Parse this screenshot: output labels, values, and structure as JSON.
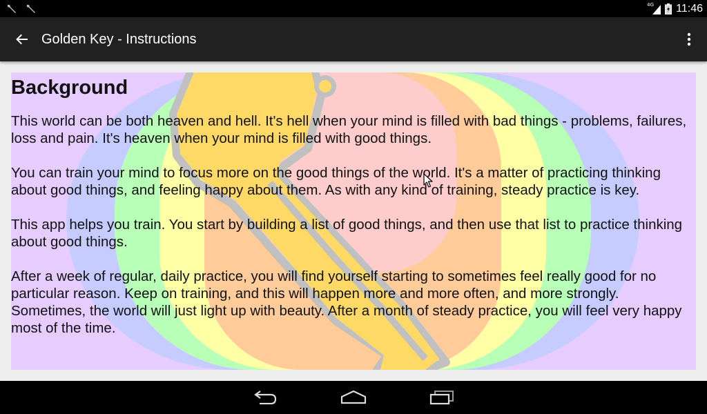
{
  "status_bar": {
    "time": "11:46",
    "network_type": "4G",
    "left_icons": [
      "tool-icon",
      "tool-icon"
    ],
    "right_icons": [
      "signal-icon",
      "battery-icon"
    ]
  },
  "app_bar": {
    "title": "Golden Key - Instructions",
    "back_icon": "arrow-back-icon",
    "menu_icon": "more-vert-icon",
    "background": "#212121"
  },
  "content": {
    "heading": "Background",
    "paragraphs": [
      "This world can be both heaven and hell. It's hell when your mind is filled with bad things - problems, failures, loss and pain. It's heaven when your mind is filled with good things.",
      "You can train your mind to focus more on the good things of the world. It's a matter of practicing thinking about good things, and feeling happy about them. As with any kind of training, steady practice is key.",
      "This app helps you train. You start by building a list of good things, and then use that list to practice thinking about good things.",
      "After a week of regular, daily practice, you will find yourself starting to sometimes feel really good for no particular reason. Keep on training, and this will happen more and more often, and more strongly. Sometimes, the world will just light up with beauty. After a month of steady practice, you will feel very happy most of the time."
    ],
    "background_image": "golden-key-rainbow-illustration",
    "colors": {
      "purple": "#e6ccff",
      "blue": "#c6ccff",
      "green": "#b8ffb8",
      "yellow": "#ffffa6",
      "orange": "#ffcc99",
      "red": "#ffcccc",
      "key_gold": "#ffd966",
      "key_outline": "#c0c0c0"
    }
  },
  "nav_bar": {
    "buttons": [
      "back-nav-icon",
      "home-nav-icon",
      "recents-nav-icon"
    ]
  }
}
